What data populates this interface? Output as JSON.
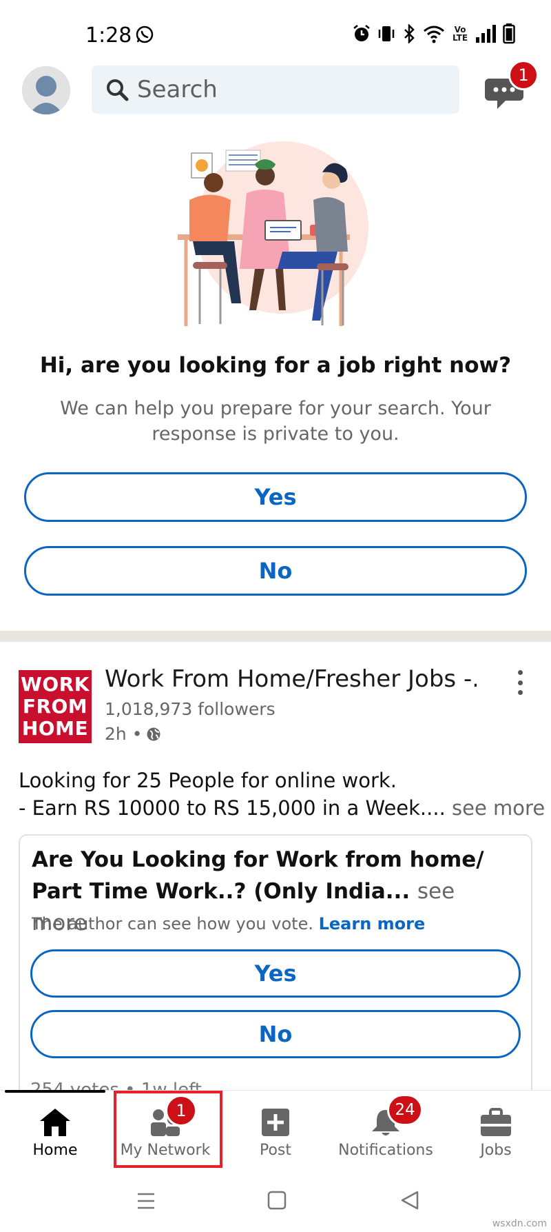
{
  "status_bar": {
    "time": "1:28",
    "icons": [
      "whatsapp-icon",
      "alarm-icon",
      "vibrate-icon",
      "bluetooth-icon",
      "wifi-icon",
      "volte-icon",
      "signal-icon",
      "battery-icon"
    ],
    "volte_label": "Vo LTE"
  },
  "top_bar": {
    "search_placeholder": "Search",
    "messages_badge": "1"
  },
  "job_prompt": {
    "question": "Hi, are you looking for a job right now?",
    "subtext": "We can help you prepare for your search. Your response is private to you.",
    "yes_label": "Yes",
    "no_label": "No"
  },
  "post": {
    "company_name": "Work From Home/Fresher Jobs -...",
    "logo_lines": [
      "WORK",
      "FROM",
      "HOME"
    ],
    "followers": "1,018,973 followers",
    "time": "2h •",
    "text_line1": "Looking for  25 People for online work.",
    "text_line2": "- Earn RS 10000 to RS 15,000 in a Week....",
    "see_more": "see more",
    "poll": {
      "question": "Are You Looking for Work from home/ Part Time Work..? (Only India...",
      "see_more": "see more",
      "note": "The author can see how you vote.",
      "learn_more": "Learn more",
      "yes_label": "Yes",
      "no_label": "No",
      "votes": "254 votes • 1w left"
    }
  },
  "bottom_nav": {
    "items": [
      {
        "label": "Home",
        "active": true
      },
      {
        "label": "My Network",
        "badge": "1"
      },
      {
        "label": "Post"
      },
      {
        "label": "Notifications",
        "badge": "24"
      },
      {
        "label": "Jobs"
      }
    ]
  },
  "colors": {
    "brand_blue": "#0a66c2",
    "badge_red": "#cc1016",
    "highlight_red": "#e8202a",
    "logo_red": "#c8102e"
  },
  "watermark": "wsxdn.com"
}
